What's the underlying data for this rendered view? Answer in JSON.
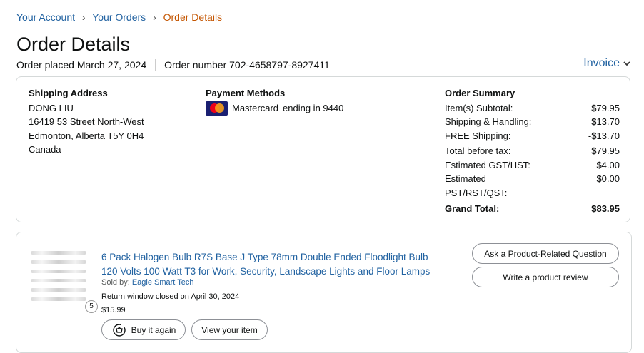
{
  "breadcrumb": {
    "account": "Your Account",
    "orders": "Your Orders",
    "current": "Order Details",
    "separator": "›"
  },
  "page_title": "Order Details",
  "order_meta": {
    "placed": "Order placed March 27, 2024",
    "number": "Order number 702-4658797-8927411"
  },
  "invoice_label": "Invoice",
  "shipping": {
    "heading": "Shipping Address",
    "lines": [
      "DONG LIU",
      "16419 53 Street North-West",
      "Edmonton, Alberta T5Y 0H4",
      "Canada"
    ]
  },
  "payment": {
    "heading": "Payment Methods",
    "method": "Mastercard",
    "ending": "ending in 9440",
    "card_icon": "mastercard-icon"
  },
  "summary": {
    "heading": "Order Summary",
    "rows": [
      {
        "label": "Item(s) Subtotal:",
        "value": "$79.95"
      },
      {
        "label": "Shipping & Handling:",
        "value": "$13.70"
      },
      {
        "label": "FREE Shipping:",
        "value": "-$13.70"
      },
      {
        "label": "Total before tax:",
        "value": "$79.95"
      },
      {
        "label": "Estimated GST/HST:",
        "value": "$4.00"
      },
      {
        "label": "Estimated PST/RST/QST:",
        "value": "$0.00"
      }
    ],
    "total_label": "Grand Total:",
    "total_value": "$83.95"
  },
  "item": {
    "title": "6 Pack Halogen Bulb R7S Base J Type 78mm Double Ended Floodlight Bulb 120 Volts 100 Watt T3 for Work, Security, Landscape Lights and Floor Lamps",
    "sold_by_label": "Sold by:",
    "seller": "Eagle Smart Tech",
    "return_window": "Return window closed on April 30, 2024",
    "price": "$15.99",
    "quantity": "5",
    "buy_again": "Buy it again",
    "view_item": "View your item"
  },
  "actions": {
    "ask_question": "Ask a Product-Related Question",
    "write_review": "Write a product review"
  },
  "colors": {
    "link": "#2162a1",
    "breadcrumb_current": "#c45500",
    "border": "#d5d9d9"
  }
}
